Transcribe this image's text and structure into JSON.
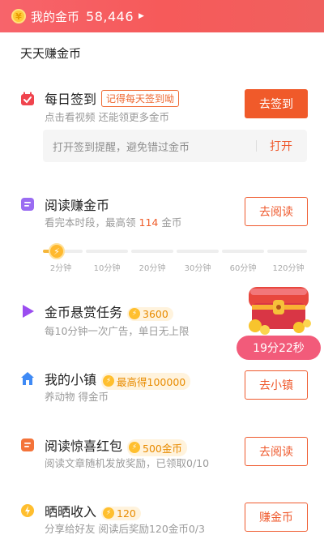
{
  "header": {
    "coin_label": "我的金币",
    "coin_amount": "58,446"
  },
  "section_title": "天天赚金币",
  "checkin": {
    "title": "每日签到",
    "tag": "记得每天签到呦",
    "sub": "点击看视频 还能领更多金币",
    "button": "去签到",
    "reminder_text": "打开签到提醒，避免错过金币",
    "reminder_action": "打开"
  },
  "reading": {
    "title": "阅读赚金币",
    "sub_prefix": "看完本时段，最高领",
    "sub_value": "114",
    "sub_suffix": "金币",
    "button": "去阅读",
    "ticks": [
      "2分钟",
      "10分钟",
      "20分钟",
      "30分钟",
      "60分钟",
      "120分钟"
    ],
    "progress_step": 1
  },
  "bounty": {
    "title": "金币悬赏任务",
    "coins": "3600",
    "sub": "每10分钟一次广告，单日无上限",
    "timer": "19分22秒"
  },
  "town": {
    "title": "我的小镇",
    "coins": "最高得100000",
    "sub": "养动物 得金币",
    "button": "去小镇"
  },
  "redpacket": {
    "title": "阅读惊喜红包",
    "coins": "500金币",
    "sub": "阅读文章随机发放奖励，已领取0/10",
    "button": "去阅读"
  },
  "income": {
    "title": "晒晒收入",
    "coins": "120",
    "sub": "分享给好友 阅读后奖励120金币0/3",
    "button": "赚金币"
  }
}
